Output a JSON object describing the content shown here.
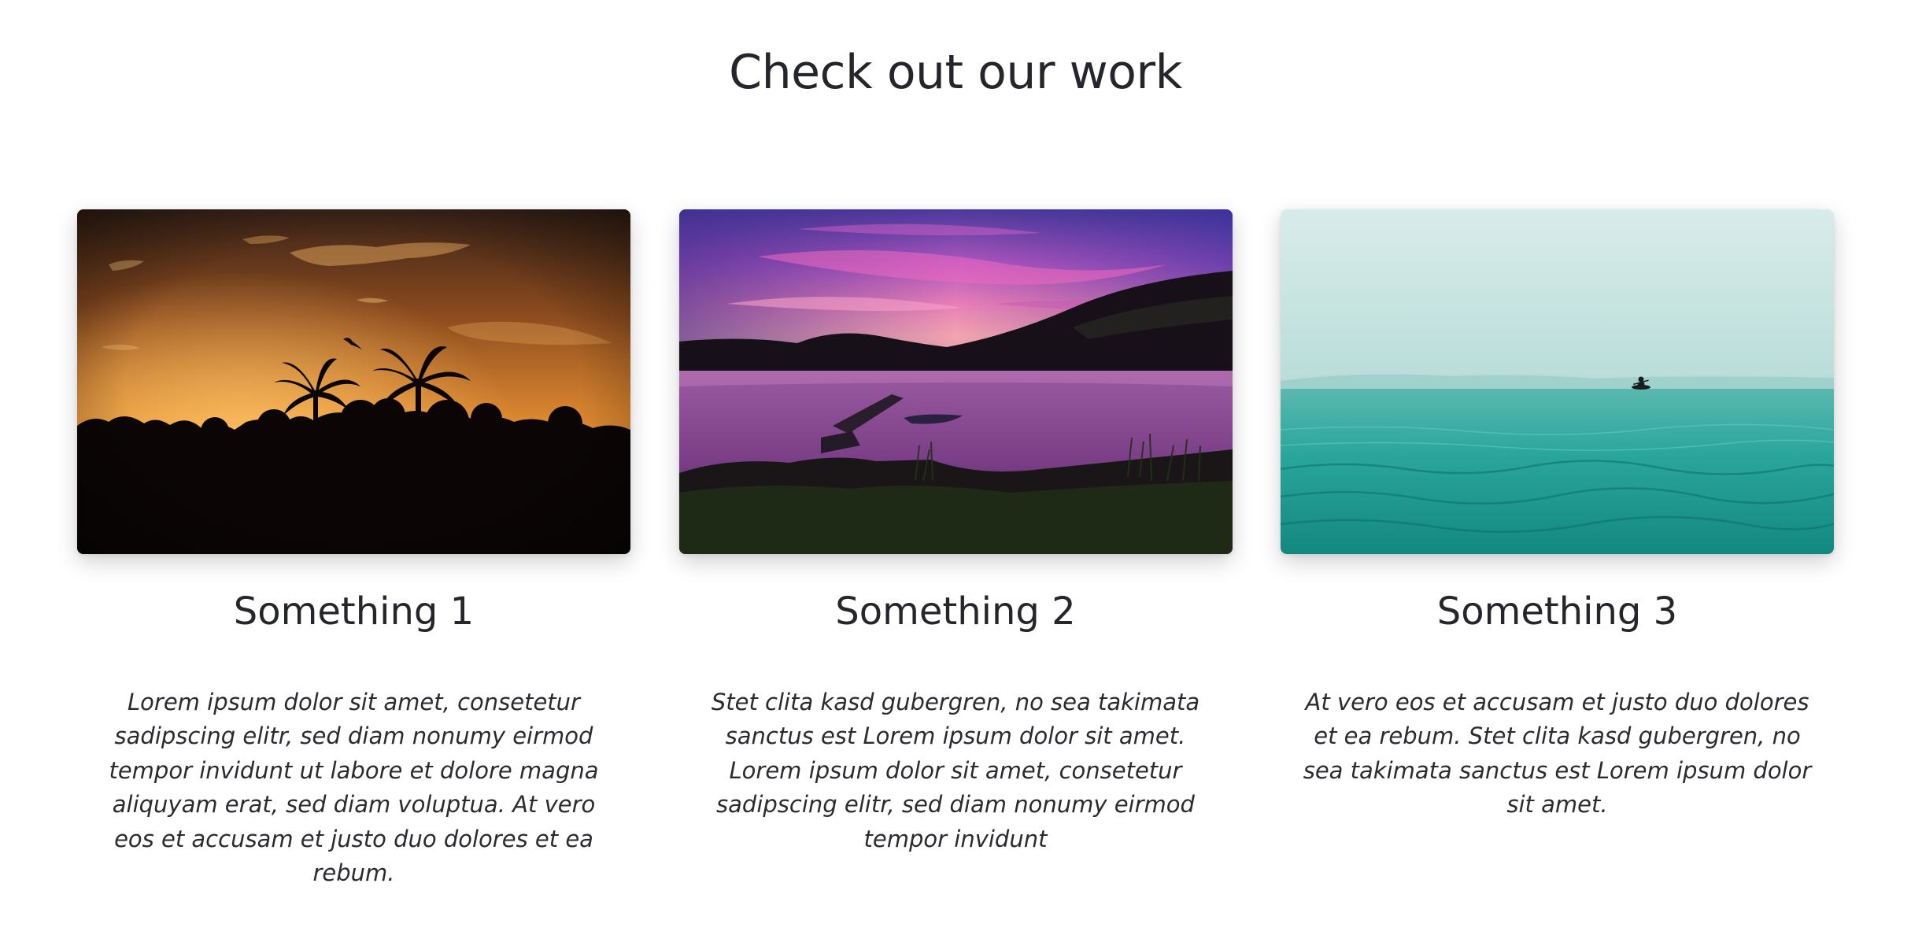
{
  "section": {
    "title": "Check out our work"
  },
  "cards": [
    {
      "image_subject": "sunset-palm-silhouette",
      "title": "Something 1",
      "text": "Lorem ipsum dolor sit amet, consetetur sadipscing elitr, sed diam nonumy eirmod tempor invidunt ut labore et dolore magna aliquyam erat, sed diam voluptua. At vero eos et accusam et justo duo dolores et ea rebum."
    },
    {
      "image_subject": "purple-lake-pier",
      "title": "Something 2",
      "text": "Stet clita kasd gubergren, no sea takimata sanctus est Lorem ipsum dolor sit amet. Lorem ipsum dolor sit amet, consetetur sadipscing elitr, sed diam nonumy eirmod tempor invidunt"
    },
    {
      "image_subject": "foggy-teal-sea-kayak",
      "title": "Something 3",
      "text": "At vero eos et accusam et justo duo dolores et ea rebum. Stet clita kasd gubergren, no sea takimata sanctus est Lorem ipsum dolor sit amet."
    }
  ],
  "colors": {
    "text": "#25262b",
    "background": "#ffffff"
  }
}
